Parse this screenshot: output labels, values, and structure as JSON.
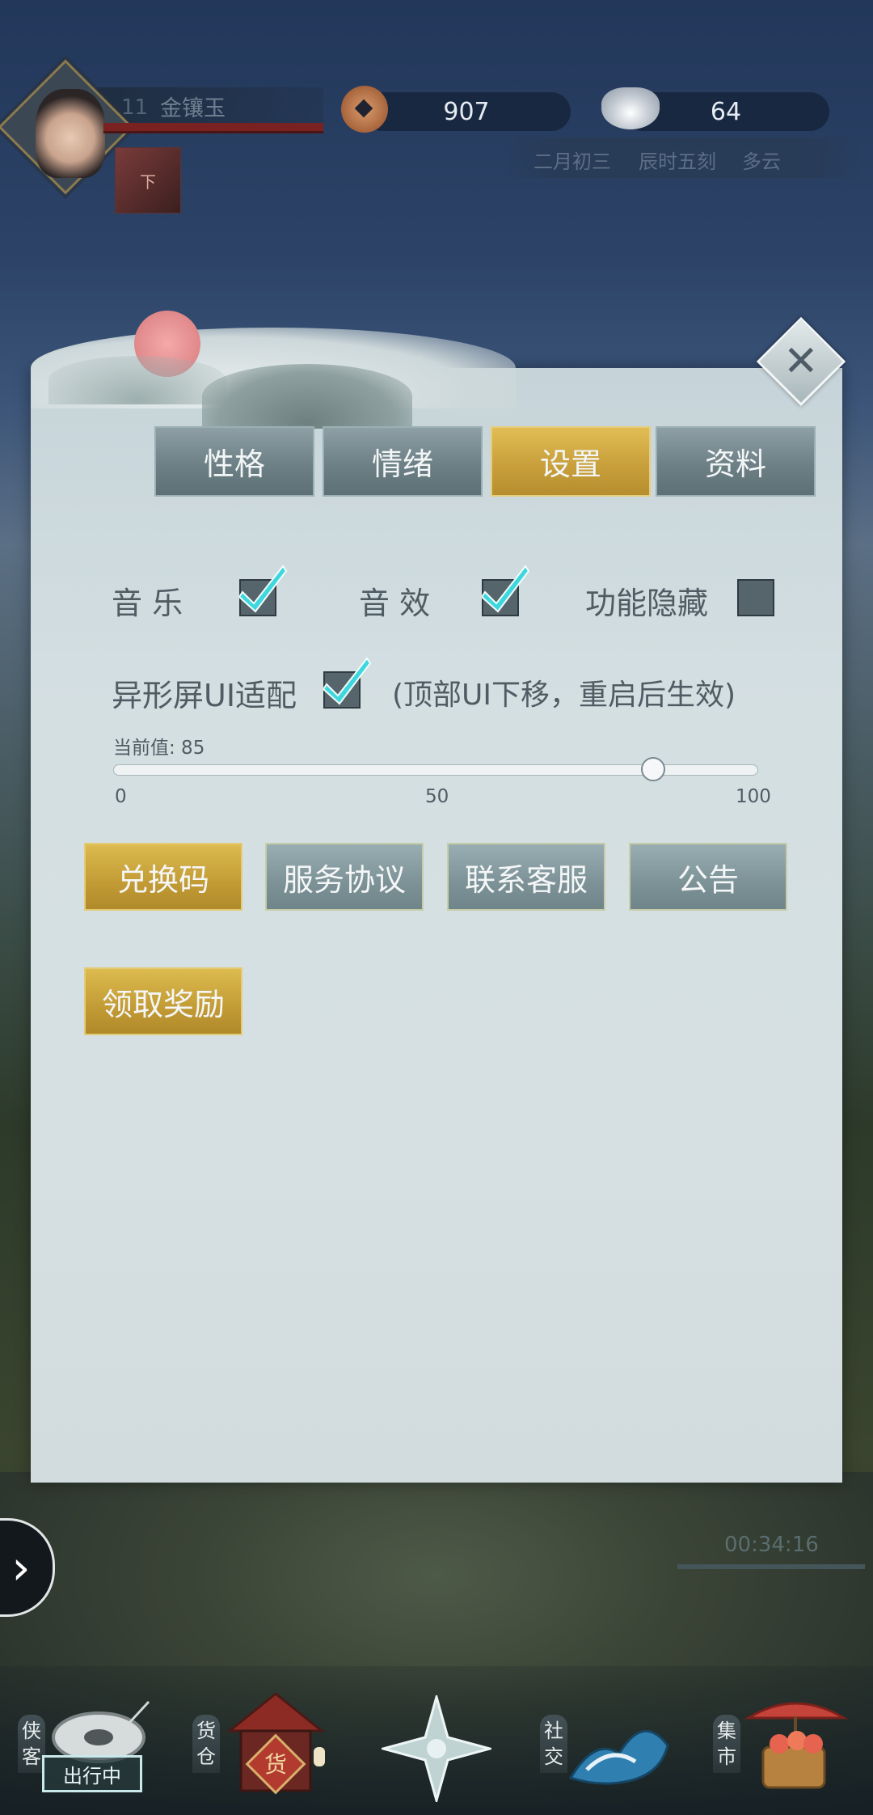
{
  "player": {
    "level": "11",
    "name": "金镶玉"
  },
  "currencies": {
    "copper": "907",
    "silver": "64"
  },
  "world": {
    "date": "二月初三",
    "time": "辰时五刻",
    "weather": "多云"
  },
  "panel": {
    "tabs": [
      "性格",
      "情绪",
      "设置",
      "资料"
    ],
    "active_tab": 2,
    "options": {
      "music_label": "音 乐",
      "sfx_label": "音 效",
      "hide_label": "功能隐藏",
      "notch_label": "异形屏UI适配",
      "notch_note": "(顶部UI下移，重启后生效)"
    },
    "checks": {
      "music": true,
      "sfx": true,
      "hide": false,
      "notch": true
    },
    "slider": {
      "current_label": "当前值: 85",
      "value": 85,
      "min": 0,
      "max": 100,
      "ticks": [
        "0",
        "50",
        "100"
      ]
    },
    "buttons": [
      "兑换码",
      "服务协议",
      "联系客服",
      "公告",
      "领取奖励"
    ]
  },
  "timer": "00:34:16",
  "bottom_nav": {
    "items": [
      {
        "label": "侠客",
        "icon": "wanderer-icon"
      },
      {
        "label": "货仓",
        "icon": "warehouse-icon"
      },
      {
        "label": "",
        "icon": "compass-star-icon"
      },
      {
        "label": "社交",
        "icon": "wave-social-icon"
      },
      {
        "label": "集市",
        "icon": "market-icon"
      }
    ],
    "status": "出行中",
    "warehouse_sign": "货"
  },
  "colors": {
    "gold": "#c9a03c",
    "gray_btn": "#7c9296",
    "panel": "#d2dcde"
  }
}
